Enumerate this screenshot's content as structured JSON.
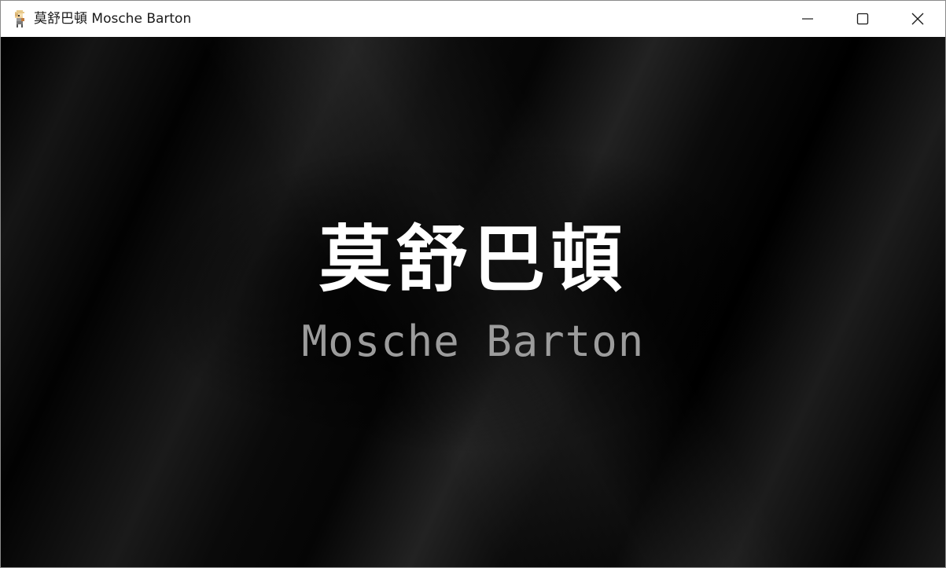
{
  "window": {
    "title": "莫舒巴頓 Mosche Barton",
    "icon": "game-character-icon",
    "controls": {
      "minimize": "minimize-icon",
      "maximize": "maximize-icon",
      "close": "close-icon"
    }
  },
  "splash": {
    "title": "莫舒巴頓",
    "subtitle": "Mosche Barton"
  },
  "colors": {
    "background": "#000000",
    "title": "#ffffff",
    "subtitle": "#9c9c9c"
  }
}
